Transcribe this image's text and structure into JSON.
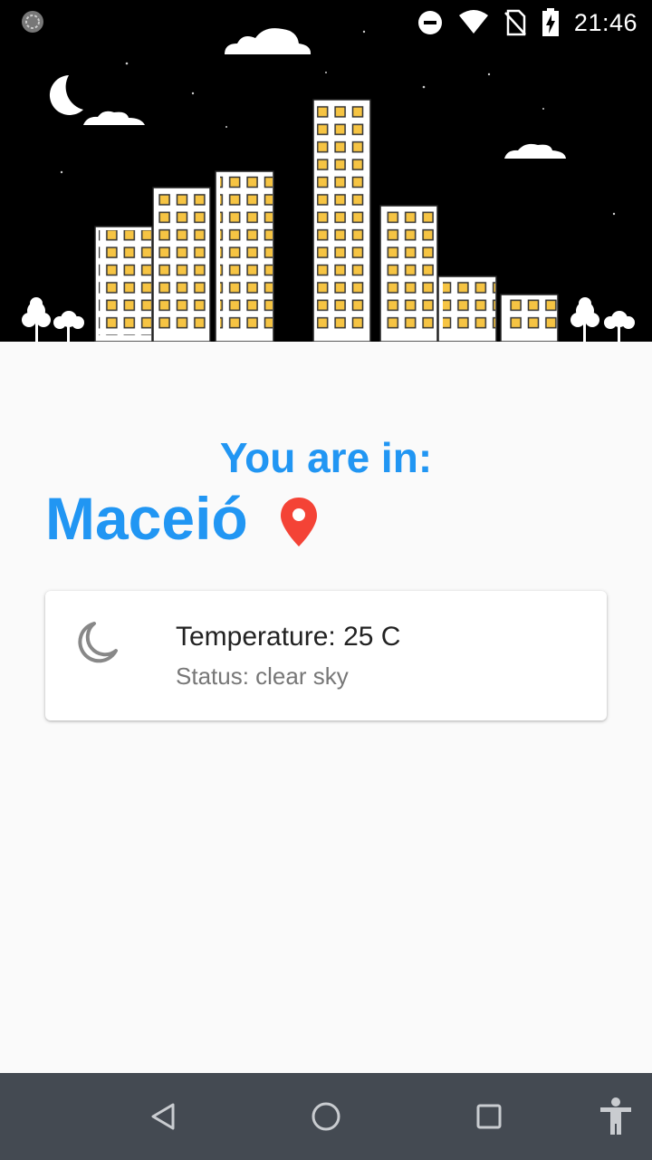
{
  "status_bar": {
    "time": "21:46",
    "icons": [
      "sync-icon",
      "do-not-disturb-icon",
      "wifi-icon",
      "no-sim-icon",
      "battery-charging-icon"
    ]
  },
  "header": {
    "background_color": "#000000",
    "illustration": "night-city-skyline"
  },
  "location": {
    "heading": "You are in:",
    "city": "Maceió",
    "pin_icon": "location-pin-icon",
    "accent_color": "#2196f3",
    "pin_color": "#f44336"
  },
  "weather_card": {
    "icon": "moon-icon",
    "temperature": "Temperature: 25 C",
    "status": "Status: clear sky"
  },
  "nav_bar": {
    "buttons": [
      "back-icon",
      "home-icon",
      "recents-icon",
      "accessibility-icon"
    ]
  }
}
